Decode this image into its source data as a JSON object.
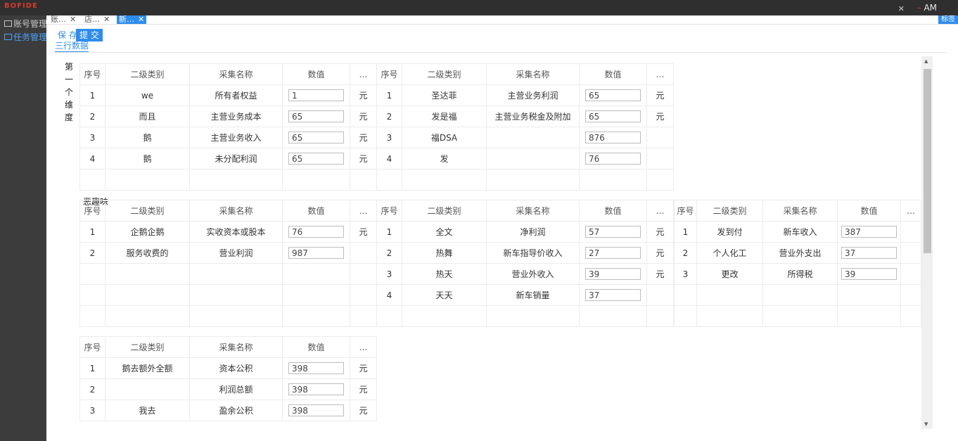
{
  "app": {
    "logo": "BOFIDE",
    "user": "AM",
    "top_close_icon": "close-icon"
  },
  "sidebar": {
    "items": [
      {
        "label": "账号管理"
      },
      {
        "label": "任务管理"
      }
    ]
  },
  "tabs": {
    "items": [
      {
        "label": "账…"
      },
      {
        "label": "店…"
      },
      {
        "label": "新…"
      }
    ],
    "right_label": "标签"
  },
  "toolbar": {
    "save_label": "保 存",
    "submit_label": "提 交"
  },
  "subtab": {
    "label": "三行数据"
  },
  "dimension": {
    "label": "第一个维度"
  },
  "group2": {
    "label": "恶趣味"
  },
  "columns": [
    "序号",
    "二级类别",
    "采集名称",
    "数值",
    "…"
  ],
  "blocks": [
    {
      "rows": [
        {
          "seq": "1",
          "cat": "we",
          "name": "所有者权益",
          "val": "1",
          "unit": "元"
        },
        {
          "seq": "2",
          "cat": "而且",
          "name": "主营业务成本",
          "val": "65",
          "unit": "元"
        },
        {
          "seq": "3",
          "cat": "鹅",
          "name": "主营业务收入",
          "val": "65",
          "unit": "元"
        },
        {
          "seq": "4",
          "cat": "鹅",
          "name": "未分配利润",
          "val": "65",
          "unit": "元"
        },
        {
          "seq": "",
          "cat": "",
          "name": "",
          "val": null,
          "unit": ""
        }
      ]
    },
    {
      "rows": [
        {
          "seq": "1",
          "cat": "圣达菲",
          "name": "主营业务利润",
          "val": "65",
          "unit": "元"
        },
        {
          "seq": "2",
          "cat": "发是福",
          "name": "主营业务税金及附加",
          "val": "65",
          "unit": "元"
        },
        {
          "seq": "3",
          "cat": "福DSA",
          "name": "",
          "val": "876",
          "unit": ""
        },
        {
          "seq": "4",
          "cat": "发",
          "name": "",
          "val": "76",
          "unit": ""
        },
        {
          "seq": "",
          "cat": "",
          "name": "",
          "val": null,
          "unit": ""
        }
      ]
    },
    {
      "rows": [
        {
          "seq": "1",
          "cat": "企鹅企鹅",
          "name": "实收资本或股本",
          "val": "76",
          "unit": "元"
        },
        {
          "seq": "2",
          "cat": "服务收费的",
          "name": "营业利润",
          "val": "987",
          "unit": ""
        },
        {
          "seq": "",
          "cat": "",
          "name": "",
          "val": null,
          "unit": ""
        },
        {
          "seq": "",
          "cat": "",
          "name": "",
          "val": null,
          "unit": ""
        },
        {
          "seq": "",
          "cat": "",
          "name": "",
          "val": null,
          "unit": ""
        }
      ]
    },
    {
      "rows": [
        {
          "seq": "1",
          "cat": "全文",
          "name": "净利润",
          "val": "57",
          "unit": "元"
        },
        {
          "seq": "2",
          "cat": "热舞",
          "name": "新车指导价收入",
          "val": "27",
          "unit": "元"
        },
        {
          "seq": "3",
          "cat": "热天",
          "name": "营业外收入",
          "val": "39",
          "unit": "元"
        },
        {
          "seq": "4",
          "cat": "天天",
          "name": "新车销量",
          "val": "37",
          "unit": ""
        },
        {
          "seq": "",
          "cat": "",
          "name": "",
          "val": null,
          "unit": ""
        }
      ]
    },
    {
      "rows": [
        {
          "seq": "1",
          "cat": "发到付",
          "name": "新车收入",
          "val": "387",
          "unit": ""
        },
        {
          "seq": "2",
          "cat": "个人化工",
          "name": "营业外支出",
          "val": "37",
          "unit": ""
        },
        {
          "seq": "3",
          "cat": "更改",
          "name": "所得税",
          "val": "39",
          "unit": ""
        },
        {
          "seq": "",
          "cat": "",
          "name": "",
          "val": null,
          "unit": ""
        },
        {
          "seq": "",
          "cat": "",
          "name": "",
          "val": null,
          "unit": ""
        }
      ]
    },
    {
      "rows": [
        {
          "seq": "1",
          "cat": "鹅去额外全额",
          "name": "资本公积",
          "val": "398",
          "unit": "元"
        },
        {
          "seq": "2",
          "cat": "",
          "name": "利润总额",
          "val": "398",
          "unit": "元"
        },
        {
          "seq": "3",
          "cat": "我去",
          "name": "盈余公积",
          "val": "398",
          "unit": "元"
        }
      ]
    }
  ]
}
